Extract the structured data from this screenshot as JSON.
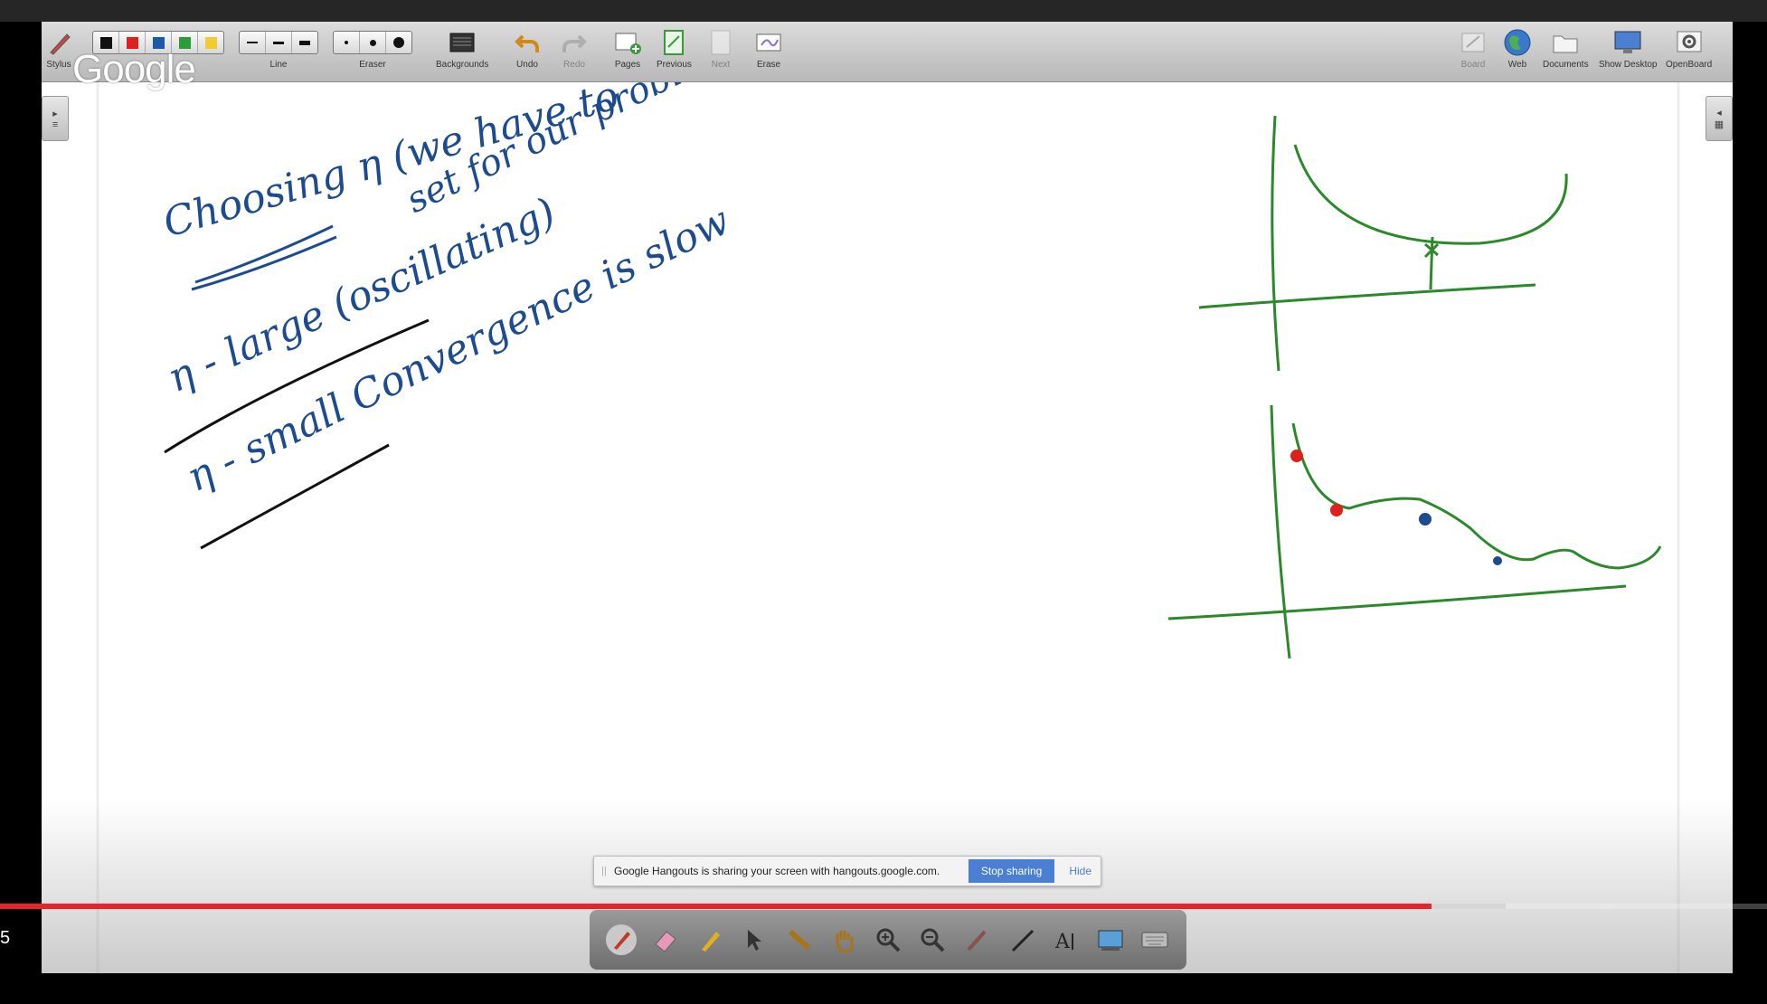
{
  "brand": {
    "watermark": "Google"
  },
  "toolbar": {
    "stylus": "Stylus",
    "colors_hex": [
      "#111111",
      "#e02020",
      "#1a5aa8",
      "#2a9d3a",
      "#f2cc2e"
    ],
    "line": "Line",
    "eraser": "Eraser",
    "backgrounds": "Backgrounds",
    "undo": "Undo",
    "redo": "Redo",
    "pages": "Pages",
    "previous": "Previous",
    "next": "Next",
    "erase": "Erase",
    "board": "Board",
    "web": "Web",
    "documents": "Documents",
    "show_desktop": "Show Desktop",
    "openboard": "OpenBoard"
  },
  "share_bar": {
    "message": "Google Hangouts is sharing your screen with hangouts.google.com.",
    "stop": "Stop sharing",
    "hide": "Hide"
  },
  "dock_tools": [
    "pen-icon",
    "eraser-icon",
    "marker-icon",
    "pointer-icon",
    "laser-icon",
    "hand-icon",
    "zoom-in-icon",
    "zoom-out-icon",
    "picker-icon",
    "line-icon",
    "text-icon",
    "capture-icon",
    "keyboard-icon"
  ],
  "player": {
    "time": "5",
    "progress": 0.81,
    "buffered": 0.852
  },
  "handwriting": {
    "line1": "Choosing η (we have to",
    "line1b": "set for our problem)",
    "line2": "η - large (oscillating)",
    "line3": "η - small  Convergence is slow"
  },
  "ink": {
    "blue": "#1d4b8f",
    "black": "#111111",
    "green": "#2a8a2a",
    "red": "#e0201c"
  }
}
